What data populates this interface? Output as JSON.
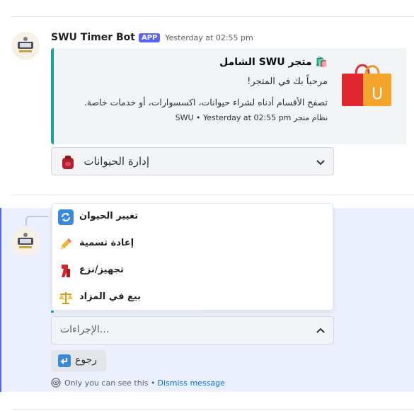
{
  "message1": {
    "author": "SWU Timer Bot",
    "badge": "APP",
    "timestamp": "Yesterday at 02:55 pm",
    "embed": {
      "accent_color": "#1aa39b",
      "title": "🛍️ متجر SWU الشامل",
      "line1": "مرحباً بك في المتجر!",
      "description": "تصفح الأقسام أدناه لشراء حيوانات، اكسسوارات، أو خدمات خاصة.",
      "footer": "SWU • Yesterday at 02:55 pm نظام متجر",
      "thumbnail_icon": "shopping-bag-icon"
    },
    "select": {
      "label": "إدارة الحيوانات",
      "icon": "backpack-icon"
    }
  },
  "message2": {
    "dropdown_items": [
      {
        "label": "تغيير الحيوان",
        "icon": "refresh-icon"
      },
      {
        "label": "إعادة تسمية",
        "icon": "pencil-icon"
      },
      {
        "label": "تجهيز/نزع",
        "icon": "scarf-icon"
      },
      {
        "label": "بيع في المزاد",
        "icon": "scales-icon"
      }
    ],
    "select_placeholder": "الإجراءات...",
    "back_button": {
      "label": "رجوع",
      "icon": "back-arrow-icon"
    },
    "ephemeral_note": "Only you can see this •",
    "dismiss_label": "Dismiss message"
  },
  "colors": {
    "brand": "#5865f2",
    "highlight": "#eceffd",
    "link": "#006ce7"
  }
}
